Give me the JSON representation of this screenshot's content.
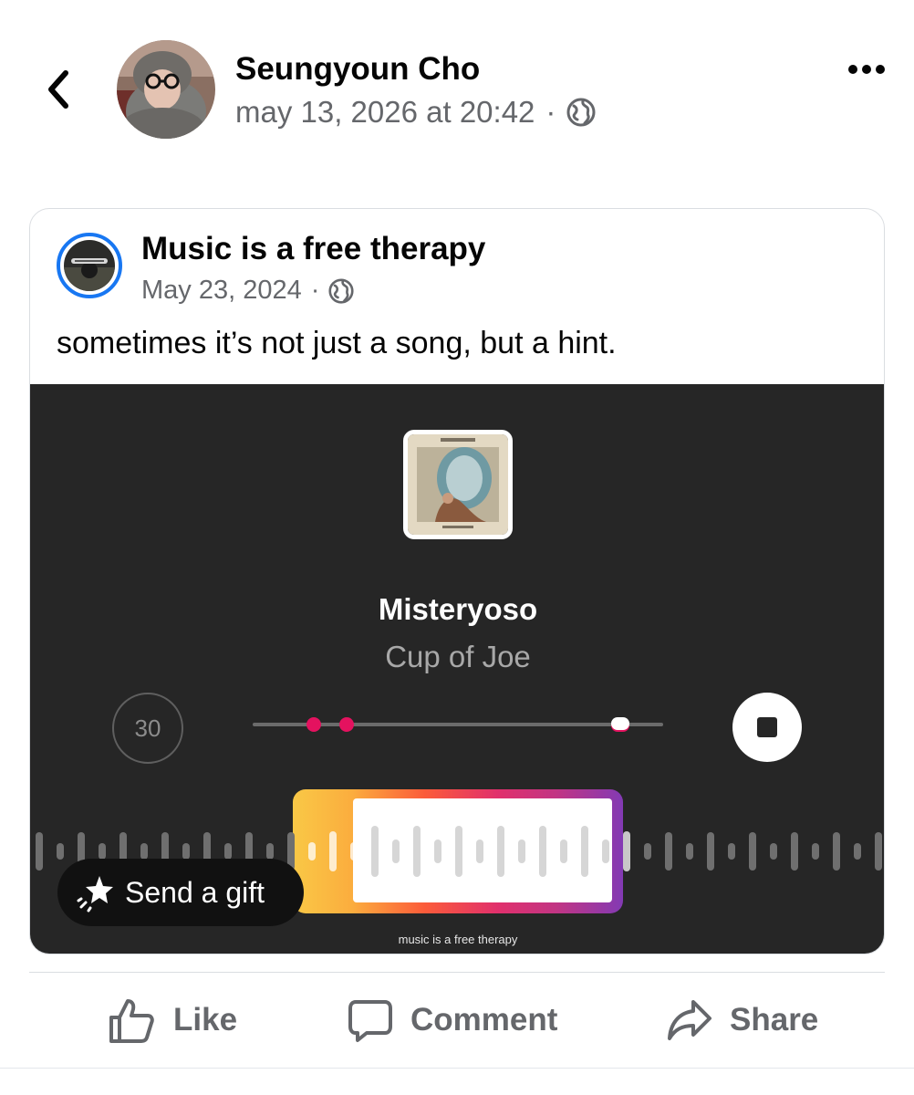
{
  "post": {
    "author": "Seungyoun Cho",
    "timestamp": "may 13, 2026 at 20:42",
    "separator": "·",
    "audience_icon": "globe-icon"
  },
  "shared_post": {
    "page_name": "Music is a free therapy",
    "date": "May 23, 2024",
    "separator": "·",
    "caption": "sometimes it’s not just a song, but a hint.",
    "accent_color": "#1877f2"
  },
  "music": {
    "title": "Misteryoso",
    "artist": "Cup of Joe",
    "skip_label": "30",
    "watermark": "music is a free therapy",
    "gift_label": "Send a gift",
    "accent_color": "#e4125f",
    "background_color": "#262626"
  },
  "actions": {
    "like": "Like",
    "comment": "Comment",
    "share": "Share"
  }
}
